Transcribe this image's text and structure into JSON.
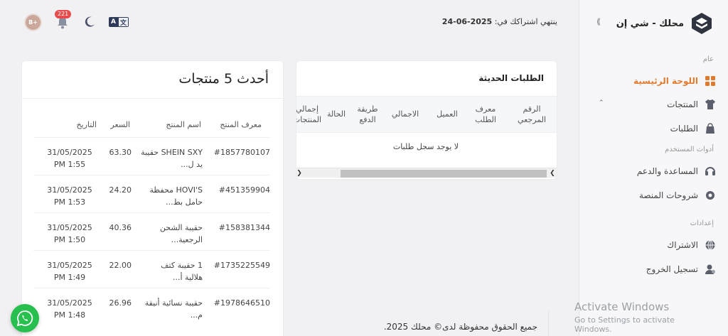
{
  "brand": {
    "name": "محلك - شي إن"
  },
  "sidebar": {
    "sections": {
      "general": "عام",
      "user_tools": "أدوات المستخدم",
      "settings": "إعدادات"
    },
    "items": [
      {
        "label": "اللوحة الرئيسية",
        "icon": "dashboard-icon",
        "active": true
      },
      {
        "label": "المنتجات",
        "icon": "shirt-icon"
      },
      {
        "label": "الطلبات",
        "icon": "bag-icon"
      },
      {
        "label": "المساعدة والدعم",
        "icon": "headset-icon"
      },
      {
        "label": "شروحات المنصة",
        "icon": "gear-icon"
      },
      {
        "label": "الاشتراك",
        "icon": "globe-icon"
      },
      {
        "label": "تسجيل الخروج",
        "icon": "user-logout-icon"
      }
    ]
  },
  "header": {
    "subscription_label": "ينتهي اشتراكك في:",
    "subscription_date": "2025-06-24",
    "notifications_count": "221",
    "avatar_text": "B+",
    "translate_left": "A",
    "translate_right": "文"
  },
  "orders": {
    "title": "الطلبات الحديثة",
    "columns": [
      "الرقم\nالمرجعي",
      "معرف\nالطلب",
      "العميل",
      "الاجمالي",
      "طريقة\nالدفع",
      "الحالة",
      "إجمالي\nالمنتجات"
    ],
    "empty_text": "لا يوجد سجل طلبات"
  },
  "products": {
    "title": "أحدث 5 منتجات",
    "columns": [
      "معرف المنتج",
      "اسم المنتج",
      "السعر",
      "التاريخ"
    ],
    "rows": [
      {
        "id": "#1857780107",
        "name": "SHEIN SXY حقيبة\nيد ل...",
        "price": "63.30",
        "date": "31/05/2025\n1:55 PM"
      },
      {
        "id": "#451359904",
        "name": "HOVI'S محفظة\nحامل بط...",
        "price": "24.20",
        "date": "31/05/2025\n1:53 PM"
      },
      {
        "id": "#158381344",
        "name": "حقيبة الشحن\nالرجعية...",
        "price": "40.36",
        "date": "31/05/2025\n1:50 PM"
      },
      {
        "id": "#1735225549",
        "name": "1 حقيبة كتف\nهلالية أ...",
        "price": "22.00",
        "date": "31/05/2025\n1:49 PM"
      },
      {
        "id": "#1978646510",
        "name": "حقيبة نسائية أنيقة\nم...",
        "price": "26.96",
        "date": "31/05/2025\n1:48 PM"
      }
    ]
  },
  "footer": {
    "text": "جميع الحقوق محفوظة لدى© محلك 2025."
  },
  "watermark": {
    "line1": "Activate Windows",
    "line2": "Go to Settings to activate Windows."
  },
  "colors": {
    "accent": "#e07a2f",
    "whatsapp": "#27c04f",
    "badge": "#e74c4c"
  }
}
